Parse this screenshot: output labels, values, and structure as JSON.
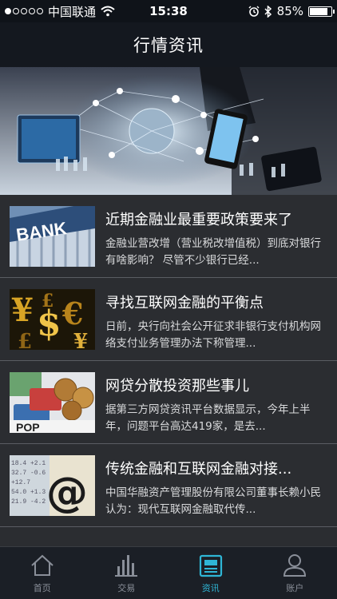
{
  "status_bar": {
    "carrier": "中国联通",
    "time": "15:38",
    "battery": "85%",
    "battery_level": 0.85
  },
  "nav": {
    "title": "行情资讯"
  },
  "articles": [
    {
      "title": "近期金融业最重要政策要来了",
      "desc": "金融业营改增（营业税改增值税）到底对银行有啥影响？ 尽管不少银行已经...",
      "thumb_icon": "bank-building-image"
    },
    {
      "title": "寻找互联网金融的平衡点",
      "desc": "日前，央行向社会公开征求非银行支付机构网络支付业务管理办法下称管理...",
      "thumb_icon": "currency-symbols-image"
    },
    {
      "title": "网贷分散投资那些事儿",
      "desc": "据第三方网贷资讯平台数据显示，今年上半年，问题平台高达419家，是去...",
      "thumb_icon": "coins-cards-image"
    },
    {
      "title": "传统金融和互联网金融对接...",
      "desc": "中国华融资产管理股份有限公司董事长赖小民认为：现代互联网金融取代传...",
      "thumb_icon": "at-sign-finance-image"
    }
  ],
  "tabs": [
    {
      "label": "首页",
      "icon": "home-icon",
      "active": false
    },
    {
      "label": "交易",
      "icon": "bar-chart-icon",
      "active": false
    },
    {
      "label": "资讯",
      "icon": "newspaper-icon",
      "active": true
    },
    {
      "label": "账户",
      "icon": "user-icon",
      "active": false
    }
  ],
  "colors": {
    "accent": "#2fb6d6",
    "inactive": "#8a8f99"
  }
}
